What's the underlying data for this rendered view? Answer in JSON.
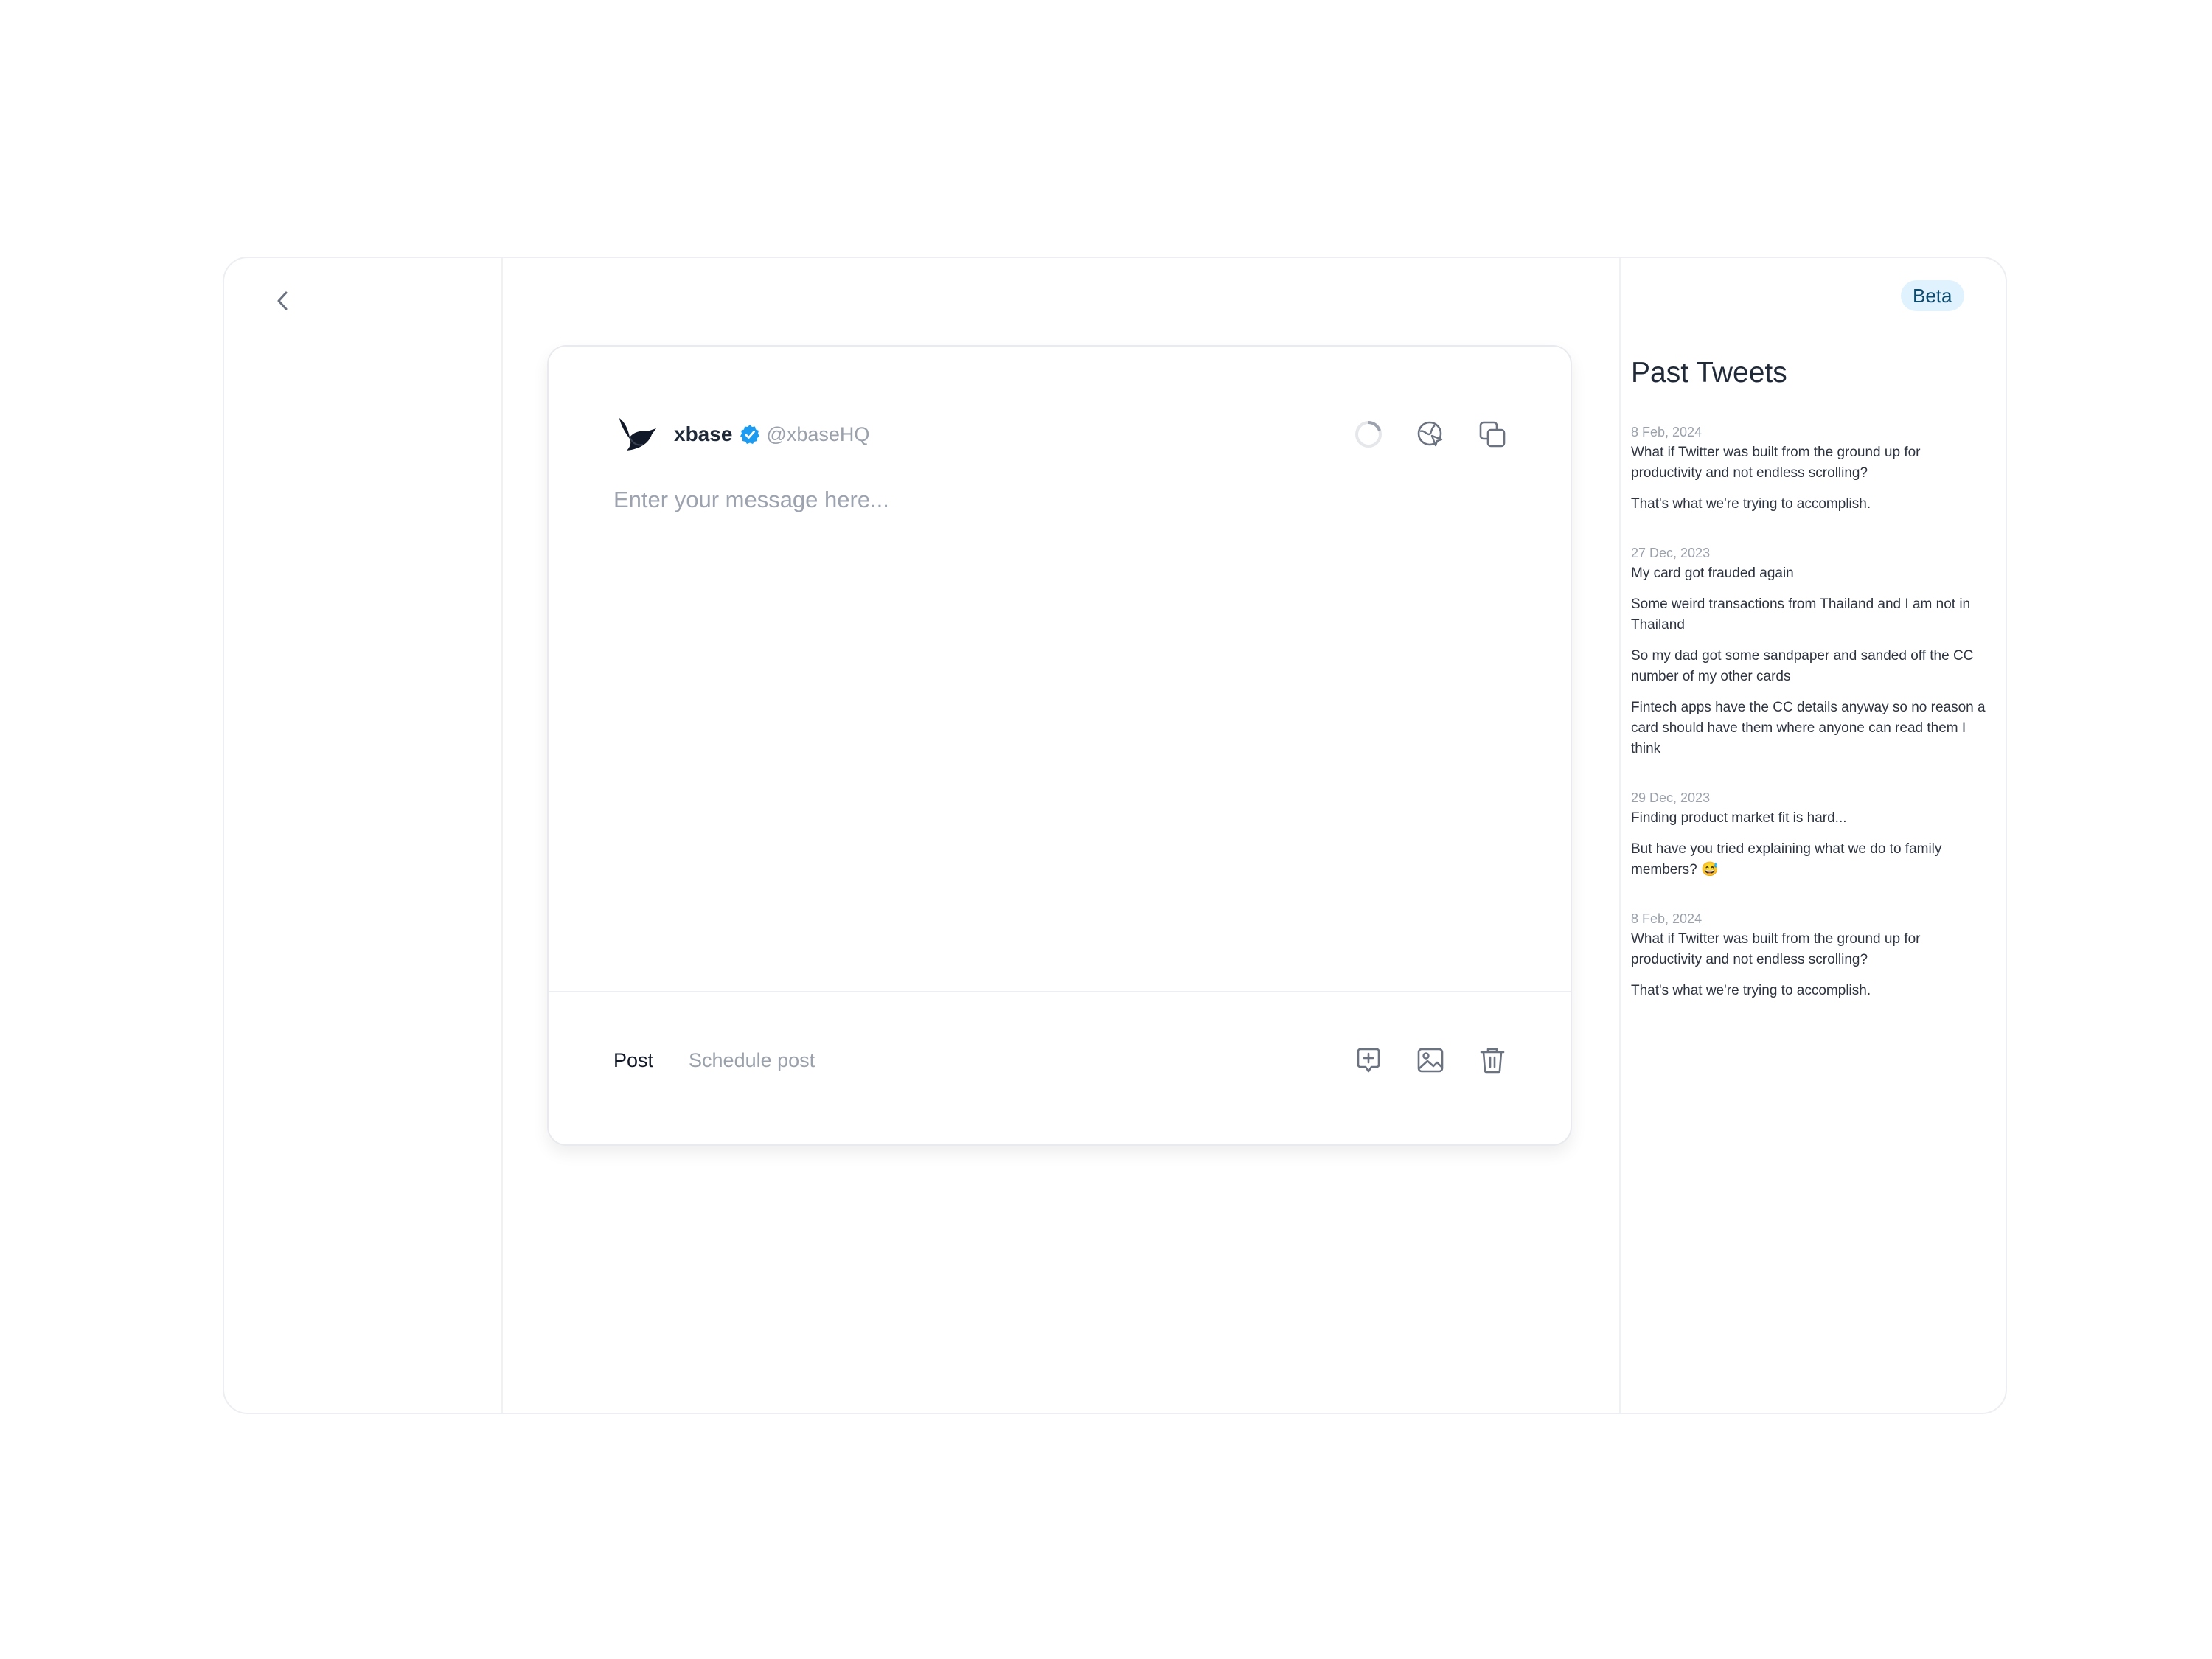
{
  "nav": {
    "back_label": "Back"
  },
  "composer": {
    "account": {
      "name": "xbase",
      "handle": "@xbaseHQ",
      "verified": true
    },
    "message_placeholder": "Enter your message here...",
    "message_value": "",
    "header_icons": [
      "progress-ring-icon",
      "globe-cursor-icon",
      "copy-icon"
    ],
    "actions": {
      "post_label": "Post",
      "schedule_label": "Schedule post"
    },
    "footer_icons": [
      "add-comment-icon",
      "image-icon",
      "trash-icon"
    ]
  },
  "sidebar": {
    "badge": "Beta",
    "title": "Past Tweets",
    "tweets": [
      {
        "date": "8 Feb, 2024",
        "lines": [
          "What if Twitter was built from the ground up for productivity and not endless scrolling?",
          "That's what we're trying to accomplish."
        ]
      },
      {
        "date": "27 Dec, 2023",
        "lines": [
          "My card got frauded again",
          "Some weird transactions from Thailand and I am not in Thailand",
          "So my dad got some sandpaper and sanded off the CC number of my other cards",
          "Fintech apps have the CC details anyway so no reason a card should have them where anyone can read them I think"
        ]
      },
      {
        "date": "29 Dec, 2023",
        "lines": [
          "Finding product market fit is hard...",
          "But have you tried explaining what we do to family members? 😅"
        ]
      },
      {
        "date": "8 Feb, 2024",
        "lines": [
          "What if Twitter was built from the ground up for productivity and not endless scrolling?",
          "That's what we're trying to accomplish."
        ]
      }
    ]
  },
  "colors": {
    "verified": "#1d9bf0",
    "badge_bg": "#e0f2fe",
    "badge_text": "#0c4a6e",
    "muted": "#9aa1ab"
  }
}
